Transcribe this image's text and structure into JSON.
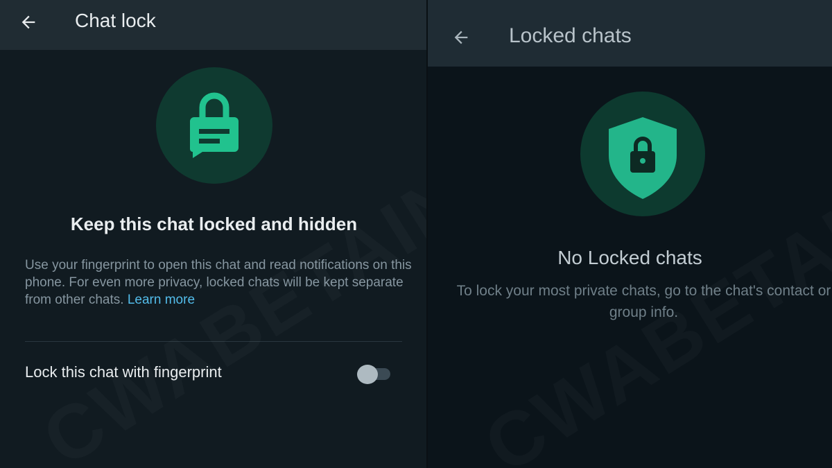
{
  "left": {
    "title": "Chat lock",
    "heading": "Keep this chat locked and hidden",
    "description": "Use your fingerprint to open this chat and read notifications on this phone. For even more privacy, locked chats will be kept separate from other chats.",
    "learn_more": "Learn more",
    "setting_label": "Lock this chat with fingerprint",
    "toggle_on": false,
    "icon": "lock-chat-icon"
  },
  "right": {
    "title": "Locked chats",
    "heading": "No Locked chats",
    "description": "To lock your most private chats, go to the chat's contact or group info.",
    "icon": "shield-lock-icon"
  },
  "watermark": "CWABETAINFO",
  "colors": {
    "accent_green": "#00a884",
    "icon_green": "#21c28e",
    "link_blue": "#53bdeb",
    "background_dark": "#111b21",
    "header_dark": "#202c33"
  }
}
